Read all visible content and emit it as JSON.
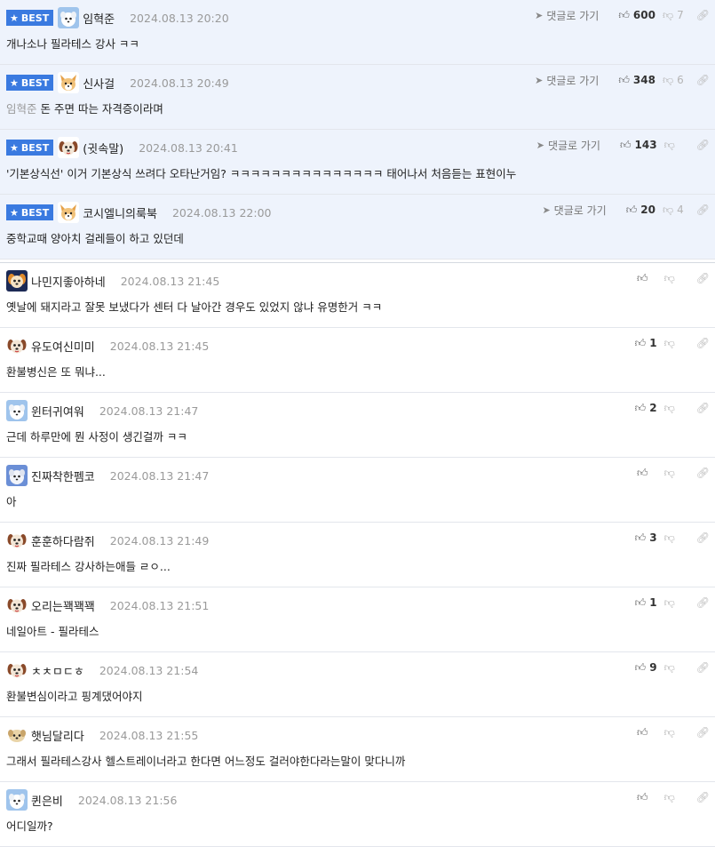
{
  "labels": {
    "best": "BEST",
    "reply_link": "댓글로 가기"
  },
  "best_comments": [
    {
      "avatar": "blue",
      "nick": "임혁준",
      "date": "2024.08.13 20:20",
      "mention": "",
      "text": "개나소나 필라테스 강사 ㅋㅋ",
      "likes": "600",
      "dislikes": "7"
    },
    {
      "avatar": "fox",
      "nick": "신사걸",
      "date": "2024.08.13 20:49",
      "mention": "임혁준",
      "text": "돈 주면 따는 자격증이라며",
      "likes": "348",
      "dislikes": "6"
    },
    {
      "avatar": "dog",
      "nick": "(귓속말)",
      "date": "2024.08.13 20:41",
      "mention": "",
      "text": "'기본상식선' 이거 기본상식 쓰려다 오타난거임? ㅋㅋㅋㅋㅋㅋㅋㅋㅋㅋㅋㅋㅋㅋㅋ 태어나서 처음듣는 표현이누",
      "likes": "143",
      "dislikes": ""
    },
    {
      "avatar": "fox",
      "nick": "코시엘니의룩북",
      "date": "2024.08.13 22:00",
      "mention": "",
      "text": "중학교때 양아치 걸레들이 하고 있던데",
      "likes": "20",
      "dislikes": "4"
    }
  ],
  "comments": [
    {
      "avatar": "orange",
      "nick": "나민지좋아하네",
      "date": "2024.08.13 21:45",
      "text": "옛날에 돼지라고 잘못 보냈다가 센터 다 날아간 경우도 있었지 않냐 유명한거 ㅋㅋ",
      "likes": ""
    },
    {
      "avatar": "dog",
      "nick": "유도여신미미",
      "date": "2024.08.13 21:45",
      "text": "환불병신은 또 뭐냐...",
      "likes": "1"
    },
    {
      "avatar": "blue",
      "nick": "윈터귀여워",
      "date": "2024.08.13 21:47",
      "text": "근데 하루만에 뭔 사정이 생긴걸까 ㅋㅋ",
      "likes": "2"
    },
    {
      "avatar": "blue2",
      "nick": "진짜착한펨코",
      "date": "2024.08.13 21:47",
      "text": "아",
      "likes": ""
    },
    {
      "avatar": "dog",
      "nick": "훈훈하다람쥐",
      "date": "2024.08.13 21:49",
      "text": "진짜 필라테스 강사하는애들 ㄹㅇ...",
      "likes": "3"
    },
    {
      "avatar": "dog",
      "nick": "오리는꽥꽥꽥",
      "date": "2024.08.13 21:51",
      "text": "네일아트 - 필라테스",
      "likes": "1"
    },
    {
      "avatar": "dog",
      "nick": "ㅊㅊㅁㄷㅎ",
      "date": "2024.08.13 21:54",
      "text": "환불변심이라고 핑계댔어야지",
      "likes": "9"
    },
    {
      "avatar": "puppy",
      "nick": "햇님달리다",
      "date": "2024.08.13 21:55",
      "text": "그래서 필라테스강사 헬스트레이너라고 한다면 어느정도 걸러야한다라는말이 맞다니까",
      "likes": ""
    },
    {
      "avatar": "blue",
      "nick": "퀸은비",
      "date": "2024.08.13 21:56",
      "text": "어디일까?",
      "likes": ""
    }
  ],
  "icons": {
    "best_star": "star-icon",
    "reply_arrow": "paper-plane-icon",
    "like": "thumbs-up-icon",
    "dislike": "thumbs-down-icon",
    "link": "link-icon"
  },
  "colors": {
    "best_badge": "#3a7ae0",
    "best_bg": "#eef3fc",
    "date": "#9a9a9a",
    "mention": "#999999"
  }
}
